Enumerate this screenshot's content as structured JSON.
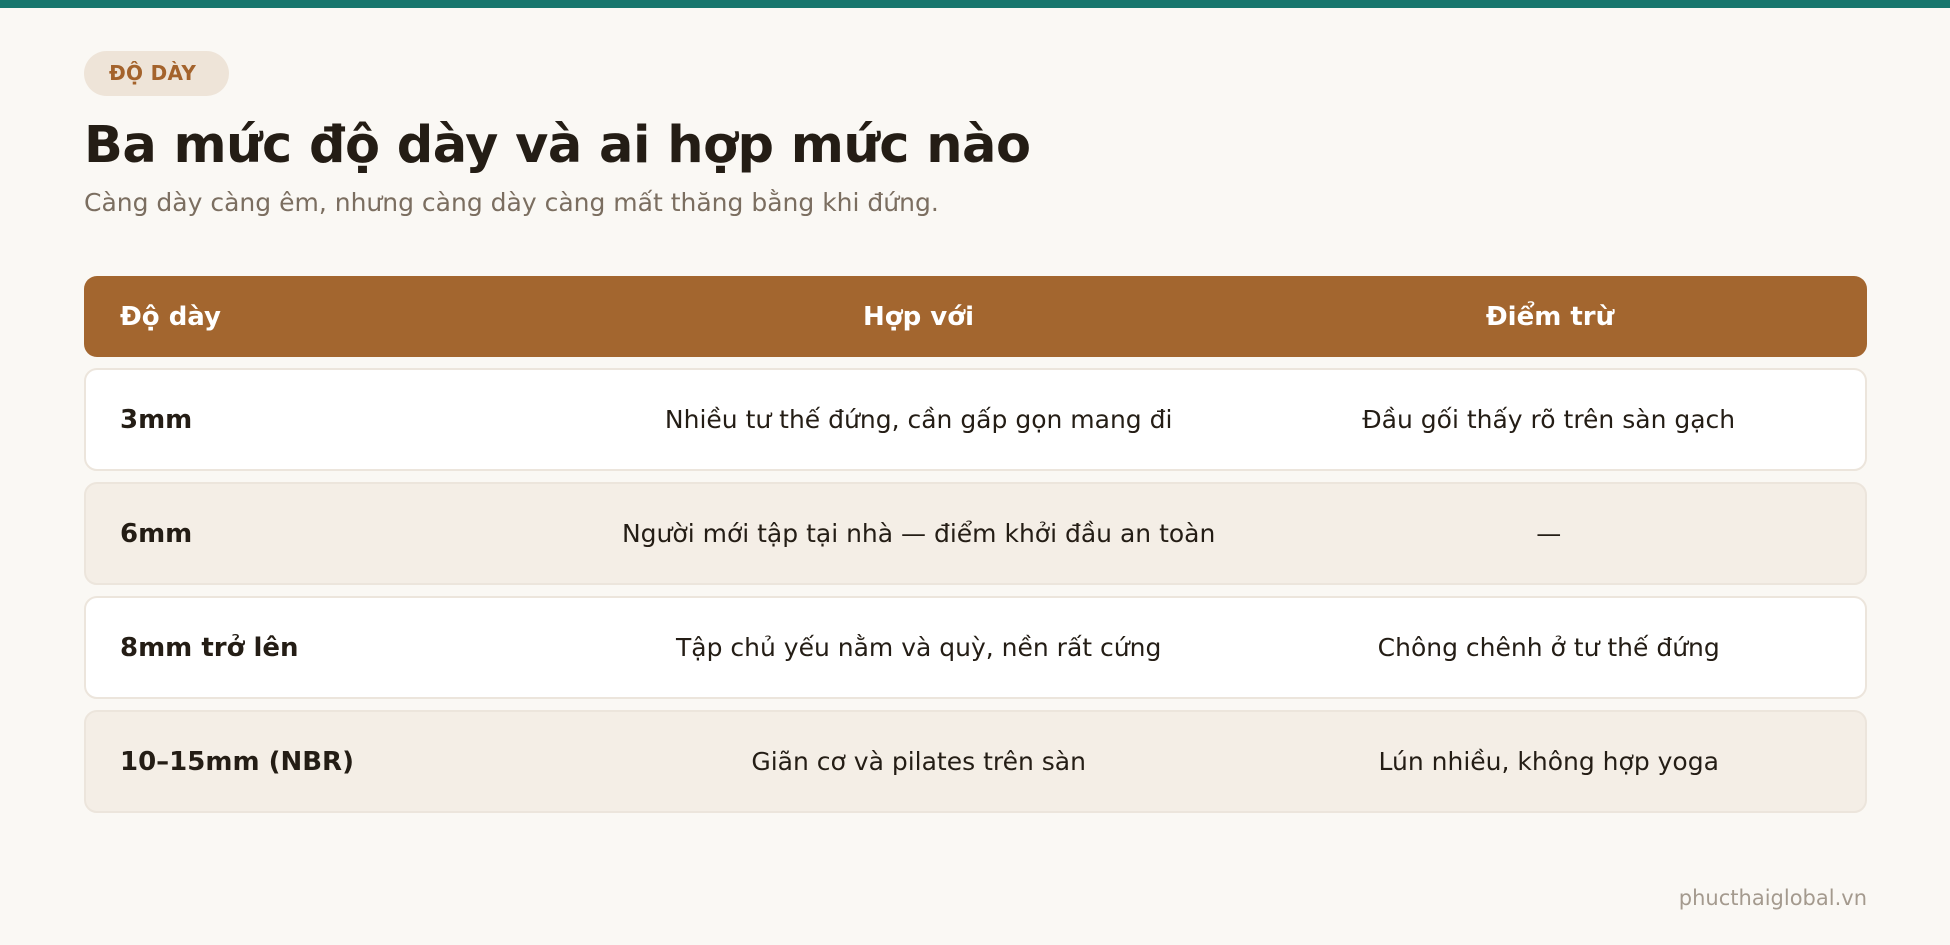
{
  "badge": "ĐỘ DÀY",
  "title": "Ba mức độ dày và ai hợp mức nào",
  "subtitle": "Càng dày càng êm, nhưng càng dày càng mất thăng bằng khi đứng.",
  "table": {
    "headers": [
      "Độ dày",
      "Hợp với",
      "Điểm trừ"
    ],
    "rows": [
      [
        "3mm",
        "Nhiều tư thế đứng, cần gấp gọn mang đi",
        "Đầu gối thấy rõ trên sàn gạch"
      ],
      [
        "6mm",
        "Người mới tập tại nhà — điểm khởi đầu an toàn",
        "—"
      ],
      [
        "8mm trở lên",
        "Tập chủ yếu nằm và quỳ, nền rất cứng",
        "Chông chênh ở tư thế đứng"
      ],
      [
        "10–15mm (NBR)",
        "Giãn cơ và pilates trên sàn",
        "Lún nhiều, không hợp yoga"
      ]
    ]
  },
  "footer": "phucthaiglobal.vn",
  "colors": {
    "accent_top": "#17766d",
    "header_bg": "#a3662f",
    "badge_bg": "#eee4d8",
    "badge_text": "#a4632c"
  }
}
